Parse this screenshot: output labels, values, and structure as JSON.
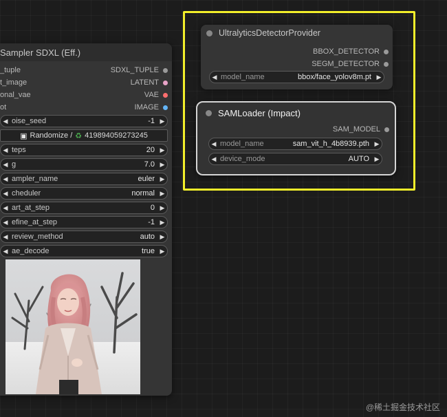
{
  "sampler_node": {
    "title": "Sampler SDXL (Eff.)",
    "io": [
      {
        "left": "_tuple",
        "right": "SDXL_TUPLE",
        "color": "#9a9a9a"
      },
      {
        "left": "t_image",
        "right": "LATENT",
        "color": "#e8a3c7"
      },
      {
        "left": "onal_vae",
        "right": "VAE",
        "color": "#ff6e6e"
      },
      {
        "left": "ot",
        "right": "IMAGE",
        "color": "#64b5f6"
      }
    ],
    "noise_seed": {
      "name": "oise_seed",
      "value": "-1"
    },
    "randomize_label": "Randomize /",
    "seed_value": "419894059273245",
    "widgets": [
      {
        "name": "teps",
        "value": "20"
      },
      {
        "name": "g",
        "value": "7.0"
      },
      {
        "name": "ampler_name",
        "value": "euler"
      },
      {
        "name": "cheduler",
        "value": "normal"
      },
      {
        "name": "art_at_step",
        "value": "0"
      },
      {
        "name": "efine_at_step",
        "value": "-1"
      },
      {
        "name": "review_method",
        "value": "auto"
      },
      {
        "name": "ae_decode",
        "value": "true"
      }
    ]
  },
  "detector_node": {
    "title": "UltralyticsDetectorProvider",
    "outputs": [
      {
        "label": "BBOX_DETECTOR",
        "color": "#9a9a9a"
      },
      {
        "label": "SEGM_DETECTOR",
        "color": "#9a9a9a"
      }
    ],
    "widget": {
      "name": "model_name",
      "value": "bbox/face_yolov8m.pt"
    }
  },
  "samloader_node": {
    "title": "SAMLoader (Impact)",
    "output": {
      "label": "SAM_MODEL",
      "color": "#9a9a9a"
    },
    "widgets": [
      {
        "name": "model_name",
        "value": "sam_vit_h_4b8939.pth"
      },
      {
        "name": "device_mode",
        "value": "AUTO"
      }
    ]
  },
  "icons": {
    "left_arrow": "◀",
    "right_arrow": "▶",
    "cube": "▣",
    "recycle": "♻"
  },
  "watermark": "@稀土掘金技术社区"
}
